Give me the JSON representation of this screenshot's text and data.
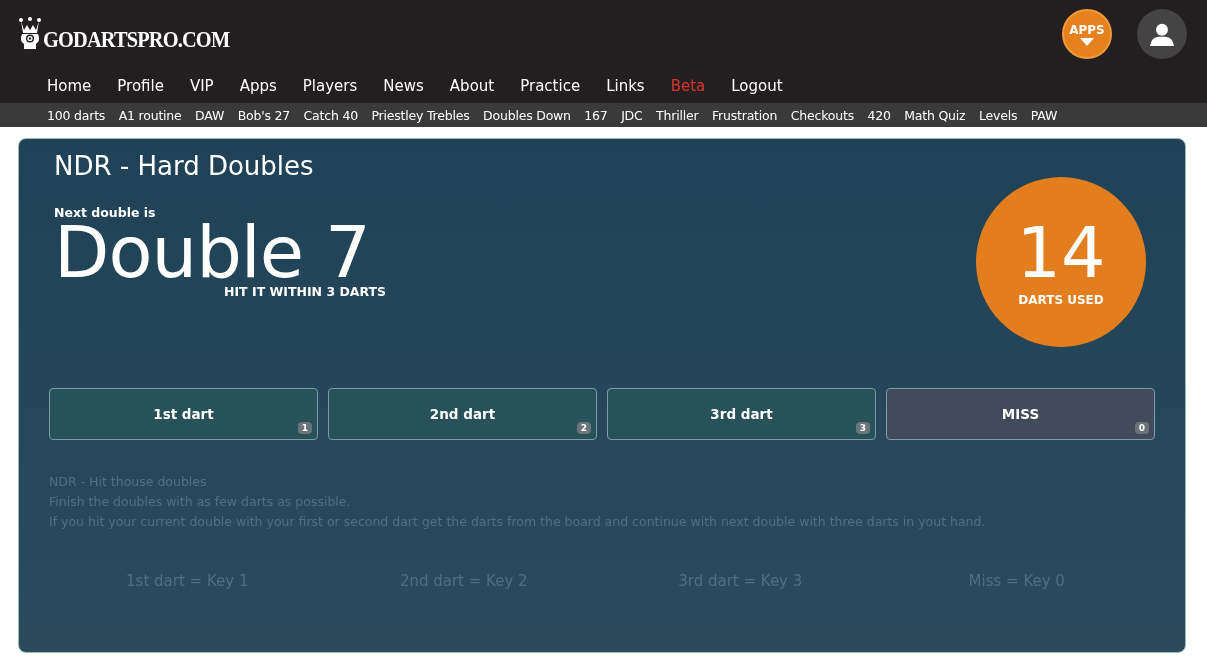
{
  "logo": {
    "text": "GODARTSPRO.COM"
  },
  "header": {
    "apps_badge": "APPS"
  },
  "nav": [
    {
      "label": "Home",
      "highlighted": false
    },
    {
      "label": "Profile",
      "highlighted": false
    },
    {
      "label": "VIP",
      "highlighted": false
    },
    {
      "label": "Apps",
      "highlighted": false
    },
    {
      "label": "Players",
      "highlighted": false
    },
    {
      "label": "News",
      "highlighted": false
    },
    {
      "label": "About",
      "highlighted": false
    },
    {
      "label": "Practice",
      "highlighted": false
    },
    {
      "label": "Links",
      "highlighted": false
    },
    {
      "label": "Beta",
      "highlighted": true
    },
    {
      "label": "Logout",
      "highlighted": false
    }
  ],
  "subnav": [
    "100 darts",
    "A1 routine",
    "DAW",
    "Bob's 27",
    "Catch 40",
    "Priestley Trebles",
    "Doubles Down",
    "167",
    "JDC",
    "Thriller",
    "Frustration",
    "Checkouts",
    "420",
    "Math Quiz",
    "Levels",
    "PAW"
  ],
  "game": {
    "title": "NDR - Hard Doubles",
    "next_label": "Next double is",
    "target": "Double 7",
    "hint": "HIT IT WITHIN 3 DARTS",
    "darts_used": "14",
    "darts_used_label": "DARTS USED",
    "buttons": [
      {
        "label": "1st dart",
        "key": "1",
        "kind": "hit"
      },
      {
        "label": "2nd dart",
        "key": "2",
        "kind": "hit"
      },
      {
        "label": "3rd dart",
        "key": "3",
        "kind": "hit"
      },
      {
        "label": "MISS",
        "key": "0",
        "kind": "miss"
      }
    ],
    "description": [
      "NDR - Hit thouse doubles",
      "Finish the doubles with as few darts as possible.",
      "If you hit your current double with your first or second dart get the darts from the board and continue with next double with three darts in yout hand."
    ],
    "key_hints": [
      "1st dart = Key 1",
      "2nd dart = Key 2",
      "3rd dart = Key 3",
      "Miss = Key 0"
    ]
  }
}
